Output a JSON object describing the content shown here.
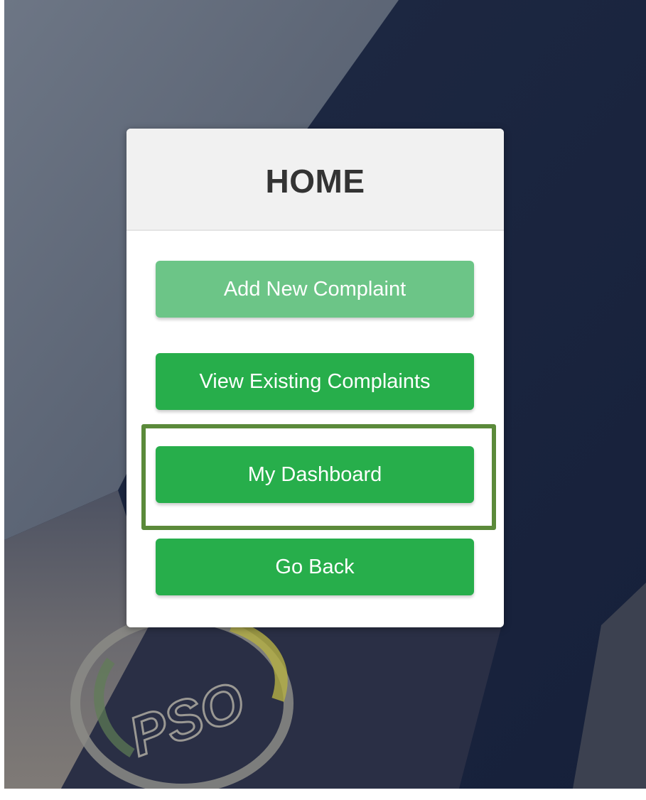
{
  "modal": {
    "title": "HOME",
    "buttons": [
      {
        "label": "Add New Complaint",
        "state": "faded"
      },
      {
        "label": "View Existing Complaints",
        "state": "normal"
      },
      {
        "label": "My Dashboard",
        "state": "highlighted"
      },
      {
        "label": "Go Back",
        "state": "normal"
      }
    ]
  },
  "background": {
    "logo_text": "PSO"
  },
  "colors": {
    "button_green": "#27ae4b",
    "button_green_faded": "#6cc587",
    "highlight_border": "#5b8a3a",
    "header_bg": "#f1f1f1",
    "title_color": "#333333"
  }
}
